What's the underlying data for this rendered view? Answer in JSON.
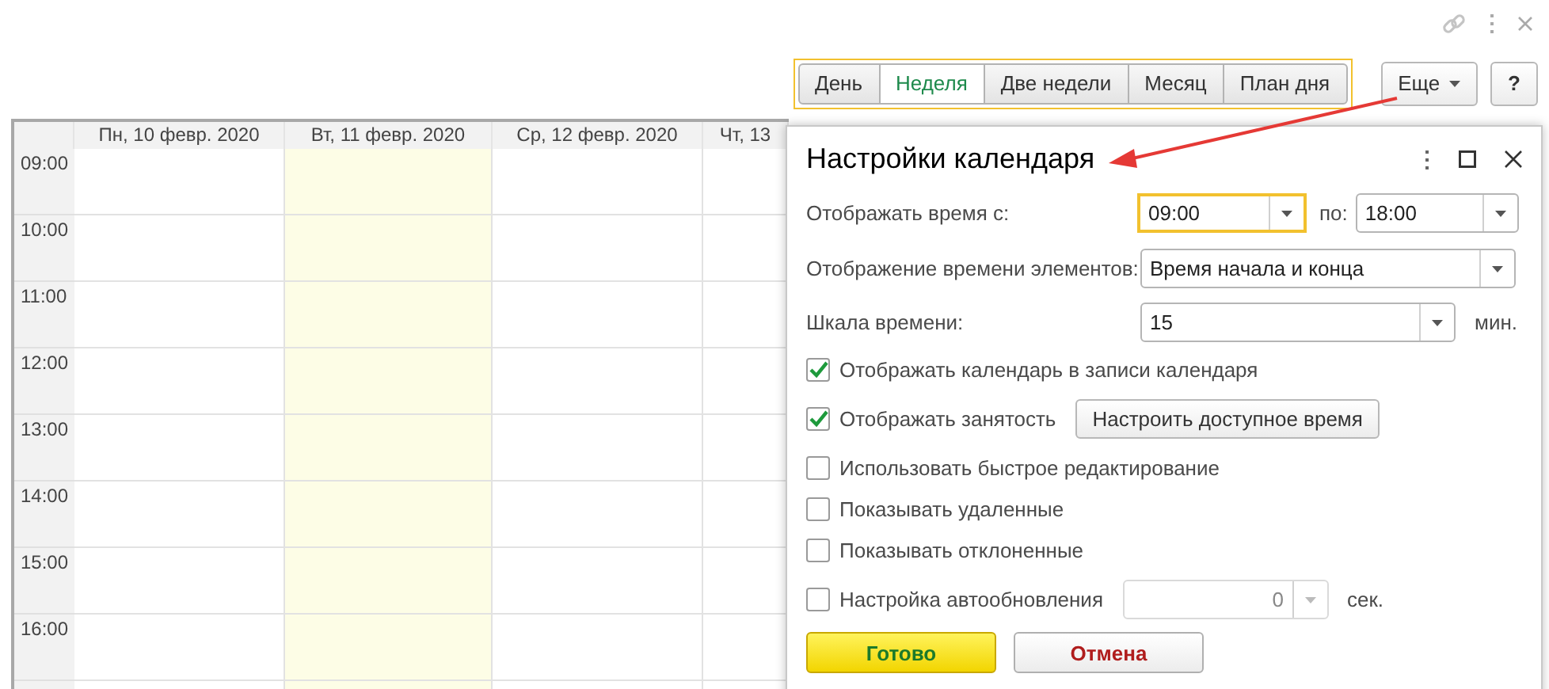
{
  "view_tabs": [
    {
      "label": "День",
      "selected": false
    },
    {
      "label": "Неделя",
      "selected": true
    },
    {
      "label": "Две недели",
      "selected": false
    },
    {
      "label": "Месяц",
      "selected": false
    },
    {
      "label": "План дня",
      "selected": false
    }
  ],
  "more_button": "Еще",
  "help_button": "?",
  "calendar": {
    "columns": [
      {
        "label": "Пн, 10 февр. 2020",
        "today": false
      },
      {
        "label": "Вт, 11 февр. 2020",
        "today": true
      },
      {
        "label": "Ср, 12 февр. 2020",
        "today": false
      },
      {
        "label": "Чт, 13",
        "today": false
      }
    ],
    "times": [
      "09:00",
      "10:00",
      "11:00",
      "12:00",
      "13:00",
      "14:00",
      "15:00",
      "16:00"
    ]
  },
  "dialog": {
    "title": "Настройки календаря",
    "time_from": {
      "label": "Отображать время с:",
      "value": "09:00",
      "focused": true
    },
    "time_to": {
      "label": "по:",
      "value": "18:00",
      "focused": false
    },
    "element_time": {
      "label": "Отображение времени элементов:",
      "value": "Время начала и конца"
    },
    "time_scale": {
      "label": "Шкала времени:",
      "value": "15",
      "unit": "мин."
    },
    "options": [
      {
        "label": "Отображать календарь в записи календаря",
        "checked": true
      },
      {
        "label": "Отображать занятость",
        "checked": true,
        "button": "Настроить доступное время"
      },
      {
        "label": "Использовать быстрое редактирование",
        "checked": false
      },
      {
        "label": "Показывать удаленные",
        "checked": false
      },
      {
        "label": "Показывать отклоненные",
        "checked": false
      }
    ],
    "autorefresh": {
      "label": "Настройка автообновления",
      "checked": false,
      "value": "0",
      "unit": "сек.",
      "disabled": true
    },
    "ok_button": "Готово",
    "cancel_button": "Отмена"
  }
}
